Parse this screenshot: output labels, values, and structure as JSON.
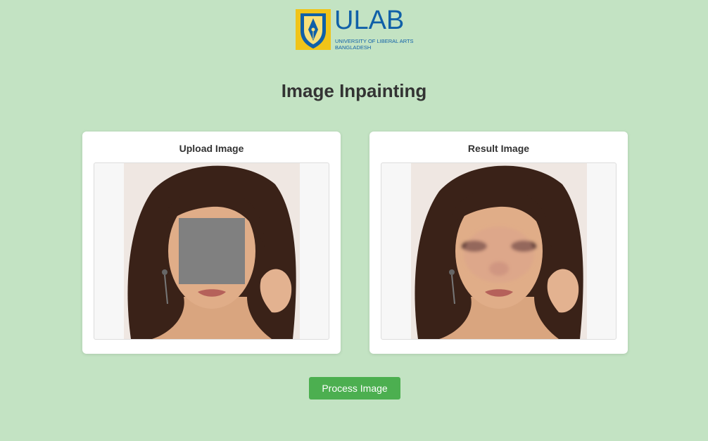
{
  "brand": {
    "name": "ULAB",
    "subtitle_line1": "UNIVERSITY OF LIBERAL ARTS",
    "subtitle_line2": "BANGLADESH",
    "logo_icon": "pen-nib-shield-emblem",
    "colors": {
      "primary": "#1060a8",
      "gold": "#f0c419"
    }
  },
  "page": {
    "title": "Image Inpainting",
    "background": "#c3e3c3"
  },
  "upload_panel": {
    "label": "Upload Image",
    "image_alt": "portrait with masked face region"
  },
  "result_panel": {
    "label": "Result Image",
    "image_alt": "inpainted portrait result"
  },
  "actions": {
    "process_label": "Process Image",
    "process_color": "#4caf50"
  }
}
